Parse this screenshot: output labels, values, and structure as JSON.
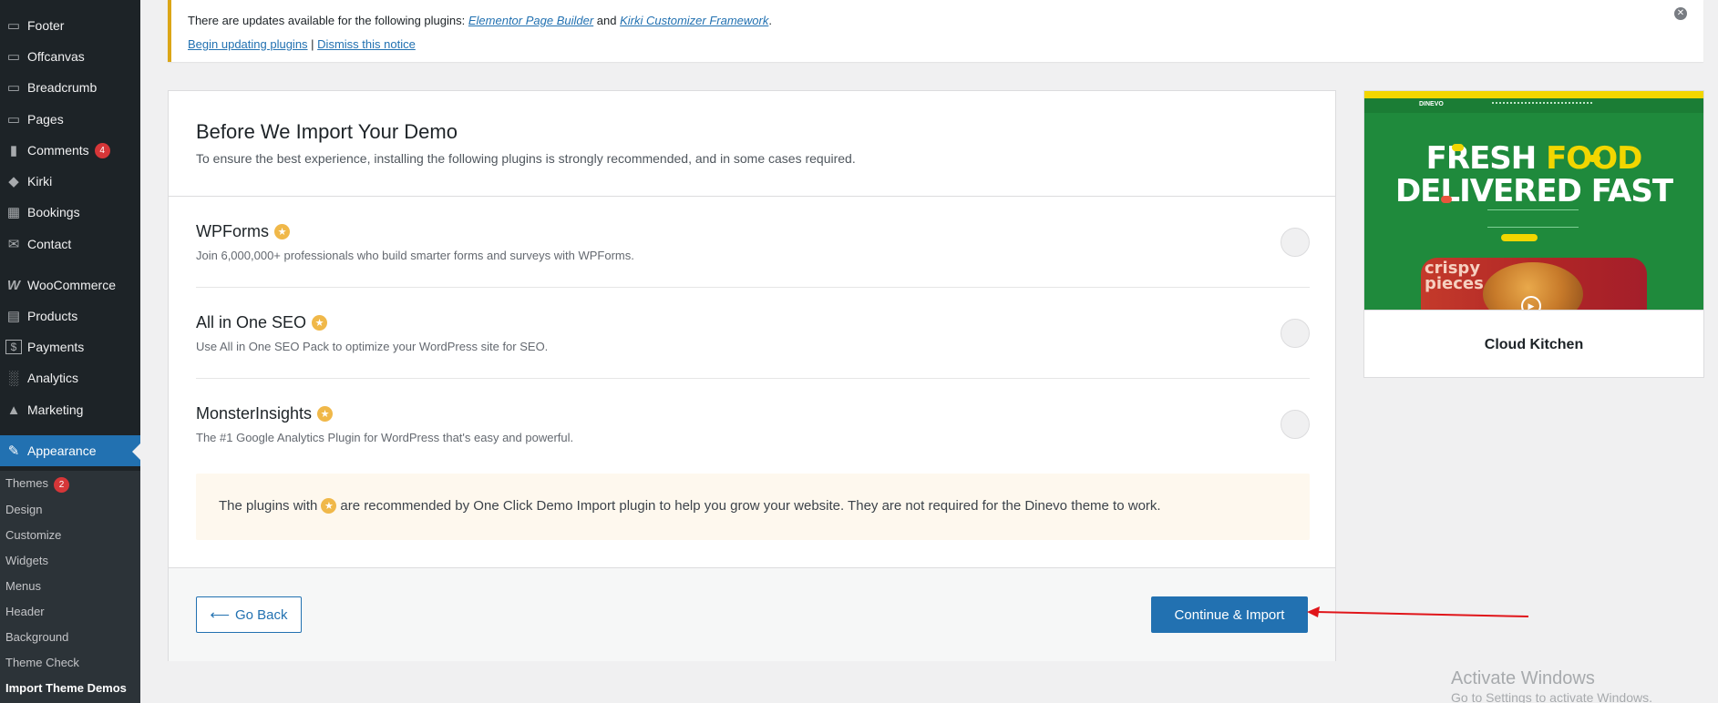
{
  "sidebar": {
    "items": [
      {
        "label": "Footer",
        "icon": "page-icon"
      },
      {
        "label": "Offcanvas",
        "icon": "page-icon"
      },
      {
        "label": "Breadcrumb",
        "icon": "page-icon"
      },
      {
        "label": "Pages",
        "icon": "page-icon"
      },
      {
        "label": "Comments",
        "icon": "comment-icon",
        "badge": "4"
      },
      {
        "label": "Kirki",
        "icon": "kirki-icon"
      },
      {
        "label": "Bookings",
        "icon": "calendar-icon"
      },
      {
        "label": "Contact",
        "icon": "mail-icon"
      },
      {
        "label": "WooCommerce",
        "icon": "woo-icon"
      },
      {
        "label": "Products",
        "icon": "archive-icon"
      },
      {
        "label": "Payments",
        "icon": "dollar-icon"
      },
      {
        "label": "Analytics",
        "icon": "bar-chart-icon"
      },
      {
        "label": "Marketing",
        "icon": "megaphone-icon"
      },
      {
        "label": "Appearance",
        "icon": "brush-icon",
        "active": true
      }
    ],
    "submenu": [
      {
        "label": "Themes",
        "badge": "2"
      },
      {
        "label": "Design"
      },
      {
        "label": "Customize"
      },
      {
        "label": "Widgets"
      },
      {
        "label": "Menus"
      },
      {
        "label": "Header"
      },
      {
        "label": "Background"
      },
      {
        "label": "Theme Check"
      },
      {
        "label": "Import Theme Demos",
        "current": true
      }
    ],
    "colors": {
      "bg": "#1d2327",
      "active": "#2271b1",
      "submenu_bg": "#2c3338"
    }
  },
  "notice": {
    "text_prefix": "There are updates available for the following plugins: ",
    "plugin1": "Elementor Page Builder",
    "and": " and ",
    "plugin2": "Kirki Customizer Framework",
    "period": ".",
    "begin_link": "Begin updating plugins",
    "separator": " | ",
    "dismiss_link": "Dismiss this notice",
    "close_icon": "close-circle-icon"
  },
  "panel": {
    "title": "Before We Import Your Demo",
    "subtitle": "To ensure the best experience, installing the following plugins is strongly recommended, and in some cases required.",
    "plugins": [
      {
        "name": "WPForms",
        "desc": "Join 6,000,000+ professionals who build smarter forms and surveys with WPForms."
      },
      {
        "name": "All in One SEO",
        "desc": "Use All in One SEO Pack to optimize your WordPress site for SEO."
      },
      {
        "name": "MonsterInsights",
        "desc": "The #1 Google Analytics Plugin for WordPress that's easy and powerful."
      }
    ],
    "recommend_prefix": "The plugins with",
    "recommend_suffix": "are recommended by One Click Demo Import plugin to help you grow your website. They are not required for the Dinevo theme to work.",
    "back_label": "Go Back",
    "continue_label": "Continue & Import"
  },
  "demo": {
    "name": "Cloud Kitchen",
    "thumb_logo": "DINEVO",
    "thumb_headline_1a": "FRESH ",
    "thumb_headline_1b": "FOOD",
    "thumb_headline_2": "DELIVERED FAST",
    "thumb_crispy": "crispy pieces"
  },
  "watermark": {
    "line1": "Activate Windows",
    "line2": "Go to Settings to activate Windows."
  }
}
